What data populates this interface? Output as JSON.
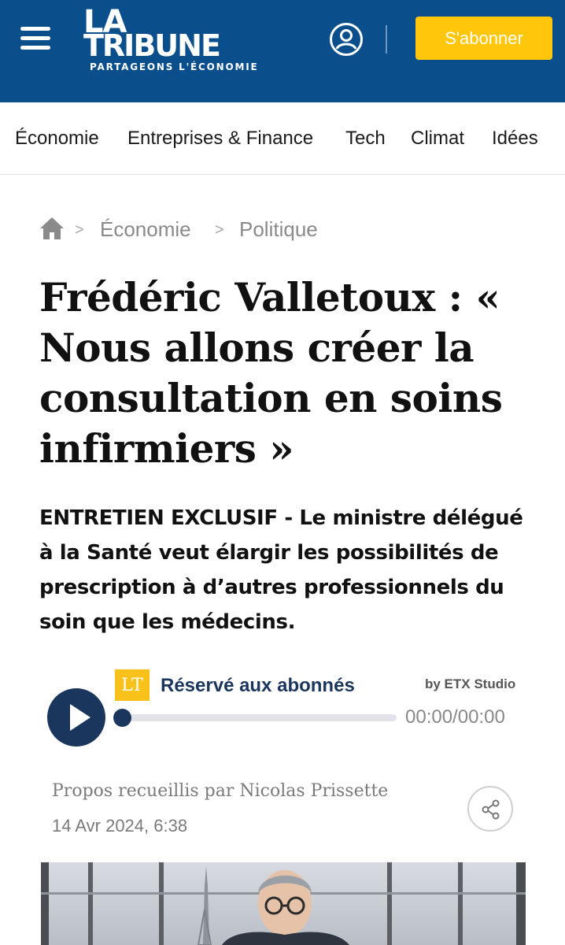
{
  "header": {
    "logo_line1": "LA",
    "logo_line2": "TRIBUNE",
    "logo_tagline": "PARTAGEONS L'ÉCONOMIE",
    "subscribe_label": "S'abonner",
    "background_color": "#0a4f8c",
    "subscribe_color": "#ffc60b",
    "icons": [
      "menu-icon",
      "account-icon"
    ]
  },
  "nav": {
    "items": [
      {
        "label": "Économie"
      },
      {
        "label": "Entreprises & Finance"
      },
      {
        "label": "Tech"
      },
      {
        "label": "Climat"
      },
      {
        "label": "Idées"
      }
    ]
  },
  "breadcrumb": {
    "home_icon": "home-icon",
    "separator": ">",
    "items": [
      {
        "label": "Économie"
      },
      {
        "label": "Politique"
      }
    ]
  },
  "article": {
    "title": "Frédéric Valletoux : « Nous allons créer la consultation en soins infirmiers »",
    "chapo": "ENTRETIEN EXCLUSIF - Le ministre délégué à la Santé veut élargir les possibilités de prescription à d’autres professionnels du soin que les médecins.",
    "byline": "Propos recueillis par Nicolas Prissette",
    "date": "14 Avr 2024, 6:38"
  },
  "audio_player": {
    "badge": "LT",
    "label": "Réservé aux abonnés",
    "provider": "by  ETX Studio",
    "time": "00:00/00:00",
    "progress": 0,
    "accent_color": "#1b365d"
  },
  "photo": {
    "description_icon": "article-photo"
  }
}
